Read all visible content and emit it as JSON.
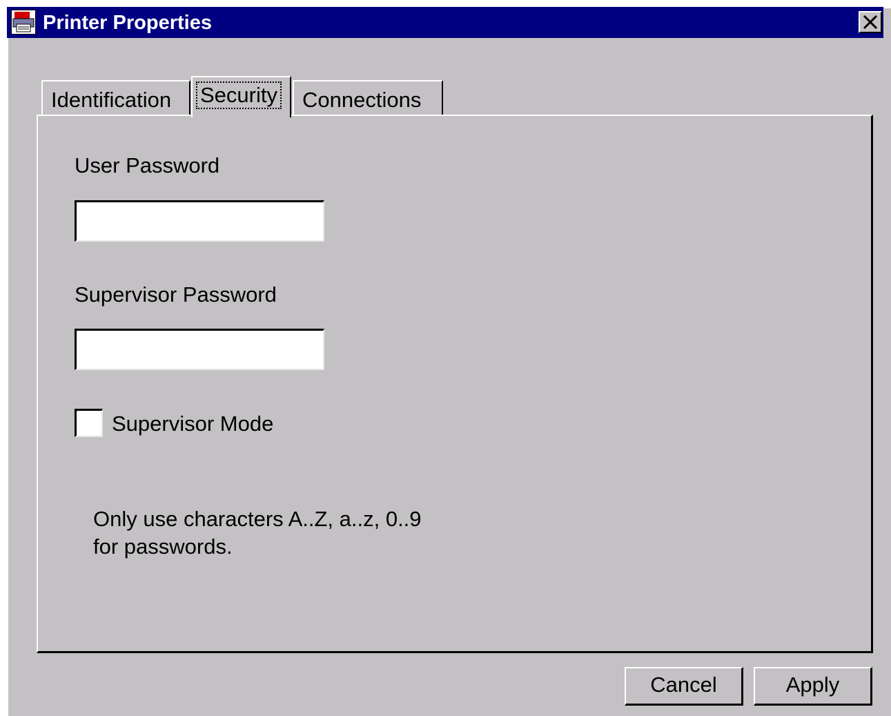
{
  "window": {
    "title": "Printer Properties",
    "close_glyph": "✕",
    "title_icon": "printer-icon",
    "titlebar_color": "#000080"
  },
  "tabs": [
    {
      "label": "Identification",
      "selected": false
    },
    {
      "label": "Security",
      "selected": true
    },
    {
      "label": "Connections",
      "selected": false
    }
  ],
  "security": {
    "user_password_label": "User Password",
    "user_password_value": "",
    "supervisor_password_label": "Supervisor Password",
    "supervisor_password_value": "",
    "supervisor_mode_label": "Supervisor Mode",
    "supervisor_mode_checked": false,
    "note_line1": "Only use characters A..Z, a..z, 0..9",
    "note_line2": "for passwords."
  },
  "buttons": {
    "cancel": "Cancel",
    "apply": "Apply"
  }
}
